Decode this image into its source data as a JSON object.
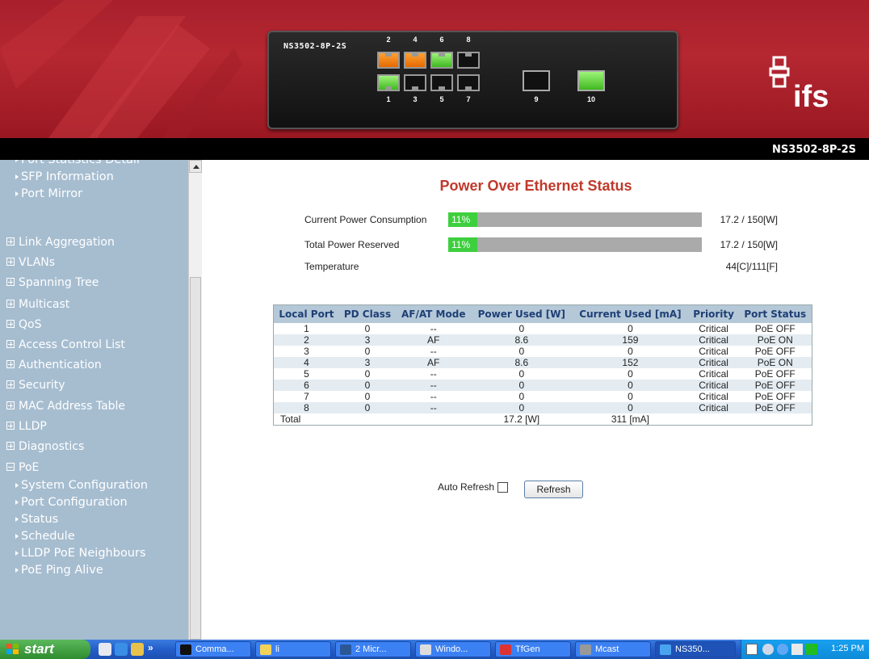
{
  "header": {
    "device_model": "NS3502-8P-2S",
    "logo_text": "ifs",
    "ports_top": [
      {
        "label": "2",
        "state": "orange"
      },
      {
        "label": "4",
        "state": "orange"
      },
      {
        "label": "6",
        "state": "green"
      },
      {
        "label": "8",
        "state": "off"
      }
    ],
    "ports_bottom": [
      {
        "label": "1",
        "state": "green"
      },
      {
        "label": "3",
        "state": "off"
      },
      {
        "label": "5",
        "state": "off"
      },
      {
        "label": "7",
        "state": "off"
      }
    ],
    "sfp_ports": [
      {
        "label": "9",
        "state": "off"
      },
      {
        "label": "10",
        "state": "green"
      }
    ]
  },
  "titlebar": {
    "model": "NS3502-8P-2S"
  },
  "sidebar": {
    "partial_item": "Port Statistics Detail",
    "items": [
      {
        "label": "SFP Information",
        "type": "sub"
      },
      {
        "label": "Port Mirror",
        "type": "sub"
      },
      {
        "label": "Link Aggregation",
        "type": "group"
      },
      {
        "label": "VLANs",
        "type": "group"
      },
      {
        "label": "Spanning Tree",
        "type": "group"
      },
      {
        "label": "Multicast",
        "type": "group"
      },
      {
        "label": "QoS",
        "type": "group"
      },
      {
        "label": "Access Control List",
        "type": "group"
      },
      {
        "label": "Authentication",
        "type": "group"
      },
      {
        "label": "Security",
        "type": "group"
      },
      {
        "label": "MAC Address Table",
        "type": "group"
      },
      {
        "label": "LLDP",
        "type": "group"
      },
      {
        "label": "Diagnostics",
        "type": "group"
      },
      {
        "label": "PoE",
        "type": "group-open"
      },
      {
        "label": "System Configuration",
        "type": "sub"
      },
      {
        "label": "Port Configuration",
        "type": "sub"
      },
      {
        "label": "Status",
        "type": "sub"
      },
      {
        "label": "Schedule",
        "type": "sub"
      },
      {
        "label": "LLDP PoE Neighbours",
        "type": "sub"
      },
      {
        "label": "PoE Ping Alive",
        "type": "sub"
      }
    ]
  },
  "main": {
    "title": "Power Over Ethernet Status",
    "current_power": {
      "label": "Current Power Consumption",
      "percent_text": "11%",
      "fraction": 0.115,
      "value": "17.2 / 150[W]"
    },
    "total_reserved": {
      "label": "Total Power Reserved",
      "percent_text": "11%",
      "fraction": 0.115,
      "value": "17.2 / 150[W]"
    },
    "temperature": {
      "label": "Temperature",
      "value": "44[C]/111[F]"
    },
    "table": {
      "headers": [
        "Local Port",
        "PD Class",
        "AF/AT Mode",
        "Power Used [W]",
        "Current Used [mA]",
        "Priority",
        "Port Status"
      ],
      "rows": [
        [
          "1",
          "0",
          "--",
          "0",
          "0",
          "Critical",
          "PoE OFF"
        ],
        [
          "2",
          "3",
          "AF",
          "8.6",
          "159",
          "Critical",
          "PoE ON"
        ],
        [
          "3",
          "0",
          "--",
          "0",
          "0",
          "Critical",
          "PoE OFF"
        ],
        [
          "4",
          "3",
          "AF",
          "8.6",
          "152",
          "Critical",
          "PoE ON"
        ],
        [
          "5",
          "0",
          "--",
          "0",
          "0",
          "Critical",
          "PoE OFF"
        ],
        [
          "6",
          "0",
          "--",
          "0",
          "0",
          "Critical",
          "PoE OFF"
        ],
        [
          "7",
          "0",
          "--",
          "0",
          "0",
          "Critical",
          "PoE OFF"
        ],
        [
          "8",
          "0",
          "--",
          "0",
          "0",
          "Critical",
          "PoE OFF"
        ]
      ],
      "total": {
        "label": "Total",
        "power": "17.2 [W]",
        "current": "311 [mA]"
      }
    },
    "auto_refresh_label": "Auto Refresh",
    "auto_refresh_checked": false,
    "refresh_button": "Refresh"
  },
  "taskbar": {
    "start_label": "start",
    "tasks": [
      {
        "label": "Comma...",
        "icon": "cmd-icon"
      },
      {
        "label": "li",
        "icon": "folder-icon"
      },
      {
        "label": "2 Micr...",
        "icon": "word-icon"
      },
      {
        "label": "Windo...",
        "icon": "window-icon"
      },
      {
        "label": "TfGen",
        "icon": "tfgen-icon"
      },
      {
        "label": "Mcast",
        "icon": "mcast-icon"
      },
      {
        "label": "NS350...",
        "icon": "ie-icon"
      }
    ],
    "clock": "1:25 PM"
  },
  "colors": {
    "header_red": "#b52731",
    "sidebar_bg": "#a6bdd0",
    "title_red": "#c0392b",
    "bar_green": "#3ecf3e",
    "table_header_bg": "#b4c8d8"
  }
}
